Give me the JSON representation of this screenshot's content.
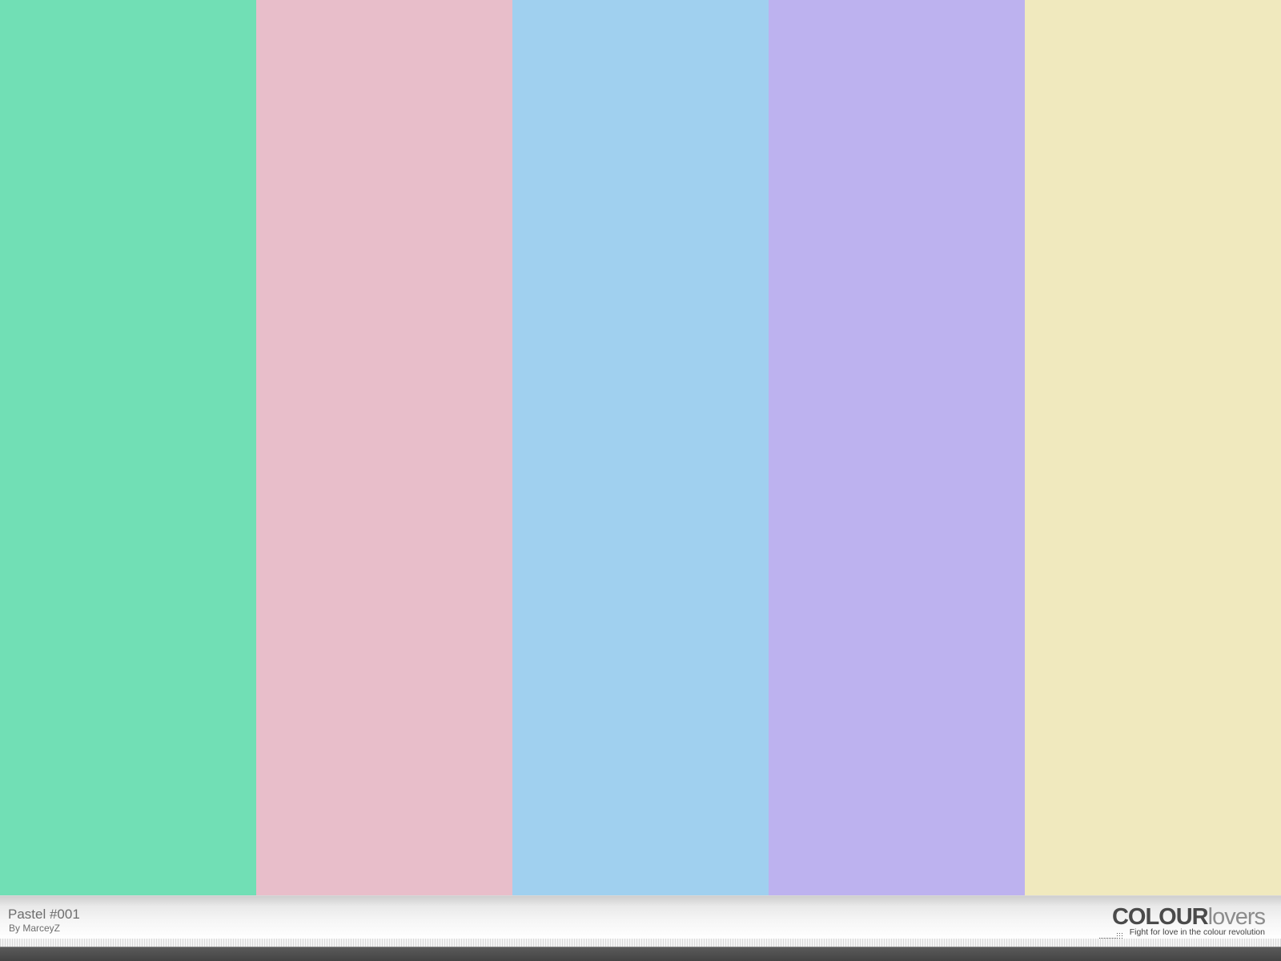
{
  "palette": {
    "title": "Pastel #001",
    "author": "By MarceyZ",
    "colors": [
      {
        "name": "swatch-1",
        "hex": "#71DFB5"
      },
      {
        "name": "swatch-2",
        "hex": "#E8BECA"
      },
      {
        "name": "swatch-3",
        "hex": "#A0D0EF"
      },
      {
        "name": "swatch-4",
        "hex": "#BDB2EF"
      },
      {
        "name": "swatch-5",
        "hex": "#F0E9BE"
      }
    ]
  },
  "branding": {
    "logo_bold": "COLOUR",
    "logo_light": "lovers",
    "tagline": "Fight for love in the colour revolution",
    "logo_colors": {
      "bold": "#4A4A4A",
      "light": "#8C8C8C"
    }
  },
  "icons": {
    "dots": "dots-icon"
  }
}
